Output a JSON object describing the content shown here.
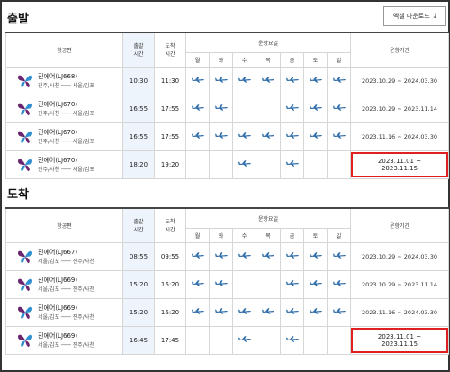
{
  "departure": {
    "title": "출발",
    "excel_button": "엑셀 다운로드",
    "headers": {
      "flight": "항공편",
      "dep_time": "출발\n시간",
      "arr_time": "도착\n시간",
      "days_group": "운항요일",
      "period": "운항기간",
      "days": [
        "월",
        "화",
        "수",
        "목",
        "금",
        "토",
        "일"
      ]
    },
    "rows": [
      {
        "name": "진에어(LJ668)",
        "route": "진주/사천 ─── 서울/김포",
        "dep": "10:30",
        "arr": "11:30",
        "days": [
          true,
          true,
          true,
          true,
          true,
          true,
          true
        ],
        "period": "2023.10.29 ~ 2024.03.30",
        "highlight": false
      },
      {
        "name": "진에어(LJ670)",
        "route": "진주/사천 ─── 서울/김포",
        "dep": "16:55",
        "arr": "17:55",
        "days": [
          true,
          true,
          false,
          false,
          true,
          true,
          true
        ],
        "period": "2023.10.29 ~ 2023.11.14",
        "highlight": false
      },
      {
        "name": "진에어(LJ670)",
        "route": "진주/사천 ─── 서울/김포",
        "dep": "16:55",
        "arr": "17:55",
        "days": [
          true,
          true,
          true,
          true,
          true,
          true,
          true
        ],
        "period": "2023.11.16 ~ 2024.03.30",
        "highlight": false
      },
      {
        "name": "진에어(LJ670)",
        "route": "진주/사천 ─── 서울/김포",
        "dep": "18:20",
        "arr": "19:20",
        "days": [
          false,
          false,
          true,
          false,
          true,
          false,
          false
        ],
        "period": "2023.11.01 ~ 2023.11.15",
        "highlight": true
      }
    ]
  },
  "arrival": {
    "title": "도착",
    "headers": {
      "flight": "항공편",
      "dep_time": "출발\n시간",
      "arr_time": "도착\n시간",
      "days_group": "운항요일",
      "period": "운항기간",
      "days": [
        "월",
        "화",
        "수",
        "목",
        "금",
        "토",
        "일"
      ]
    },
    "rows": [
      {
        "name": "진에어(LJ667)",
        "route": "서울/김포 ─── 진주/사천",
        "dep": "08:55",
        "arr": "09:55",
        "days": [
          true,
          true,
          true,
          true,
          true,
          true,
          true
        ],
        "period": "2023.10.29 ~ 2024.03.30",
        "highlight": false
      },
      {
        "name": "진에어(LJ669)",
        "route": "서울/김포 ─── 진주/사천",
        "dep": "15:20",
        "arr": "16:20",
        "days": [
          true,
          true,
          false,
          false,
          true,
          true,
          true
        ],
        "period": "2023.10.29 ~ 2023.11.14",
        "highlight": false
      },
      {
        "name": "진에어(LJ669)",
        "route": "서울/김포 ─── 진주/사천",
        "dep": "15:20",
        "arr": "16:20",
        "days": [
          true,
          true,
          true,
          true,
          true,
          true,
          true
        ],
        "period": "2023.11.16 ~ 2024.03.30",
        "highlight": false
      },
      {
        "name": "진에어(LJ669)",
        "route": "서울/김포 ─── 진주/사천",
        "dep": "16:45",
        "arr": "17:45",
        "days": [
          false,
          false,
          true,
          false,
          true,
          false,
          false
        ],
        "period": "2023.11.01 ~ 2023.11.15",
        "highlight": true
      }
    ]
  },
  "icons": {
    "airline_logo": "butterfly-logo-icon",
    "operating_day": "airplane-icon",
    "download": "download-icon"
  },
  "colors": {
    "plane": "#2a6aa8",
    "highlight_border": "#e02020",
    "time_column_bg": "#eef4fb",
    "logo_purple": "#6b2470",
    "logo_blue": "#2f8fd0"
  }
}
